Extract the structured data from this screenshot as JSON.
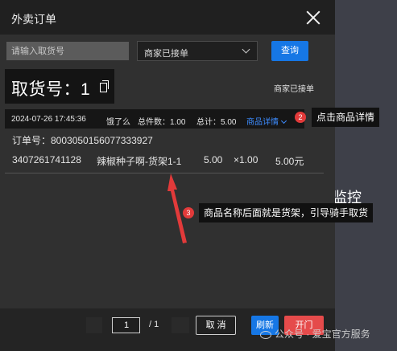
{
  "modal": {
    "title": "外卖订单"
  },
  "search": {
    "placeholder": "请输入取货号",
    "status_selected": "商家已接单",
    "query_label": "查询"
  },
  "order": {
    "pickup_label": "取货号：1",
    "status": "商家已接单",
    "datetime": "2024-07-26 17:45:36",
    "platform": "饿了么",
    "total_qty": "总件数：1.00",
    "total_price": "总计：5.00",
    "detail_link": "商品详情",
    "order_no": "订单号：8003050156077333927",
    "items": [
      {
        "barcode": "3407261741128",
        "name": "辣椒种子啊-货架1-1",
        "price": "5.00",
        "qty": "×1.00",
        "amount": "5.00元"
      }
    ]
  },
  "annotations": [
    {
      "number": "2",
      "text": "点击商品详情"
    },
    {
      "number": "3",
      "text": "商品名称后面就是货架，引导骑手取货"
    }
  ],
  "background": {
    "partial_text": "监控"
  },
  "pagination": {
    "current": "1",
    "total": "/ 1"
  },
  "footer": {
    "cancel_label": "取 消",
    "refresh_label": "刷新",
    "open_label": "开门"
  },
  "watermark": {
    "text": "公众号 · 爱宝官方服务"
  },
  "colors": {
    "primary": "#1677e5",
    "danger": "#e54b4b",
    "badge": "#e23a3a",
    "link": "#3d8cff"
  }
}
